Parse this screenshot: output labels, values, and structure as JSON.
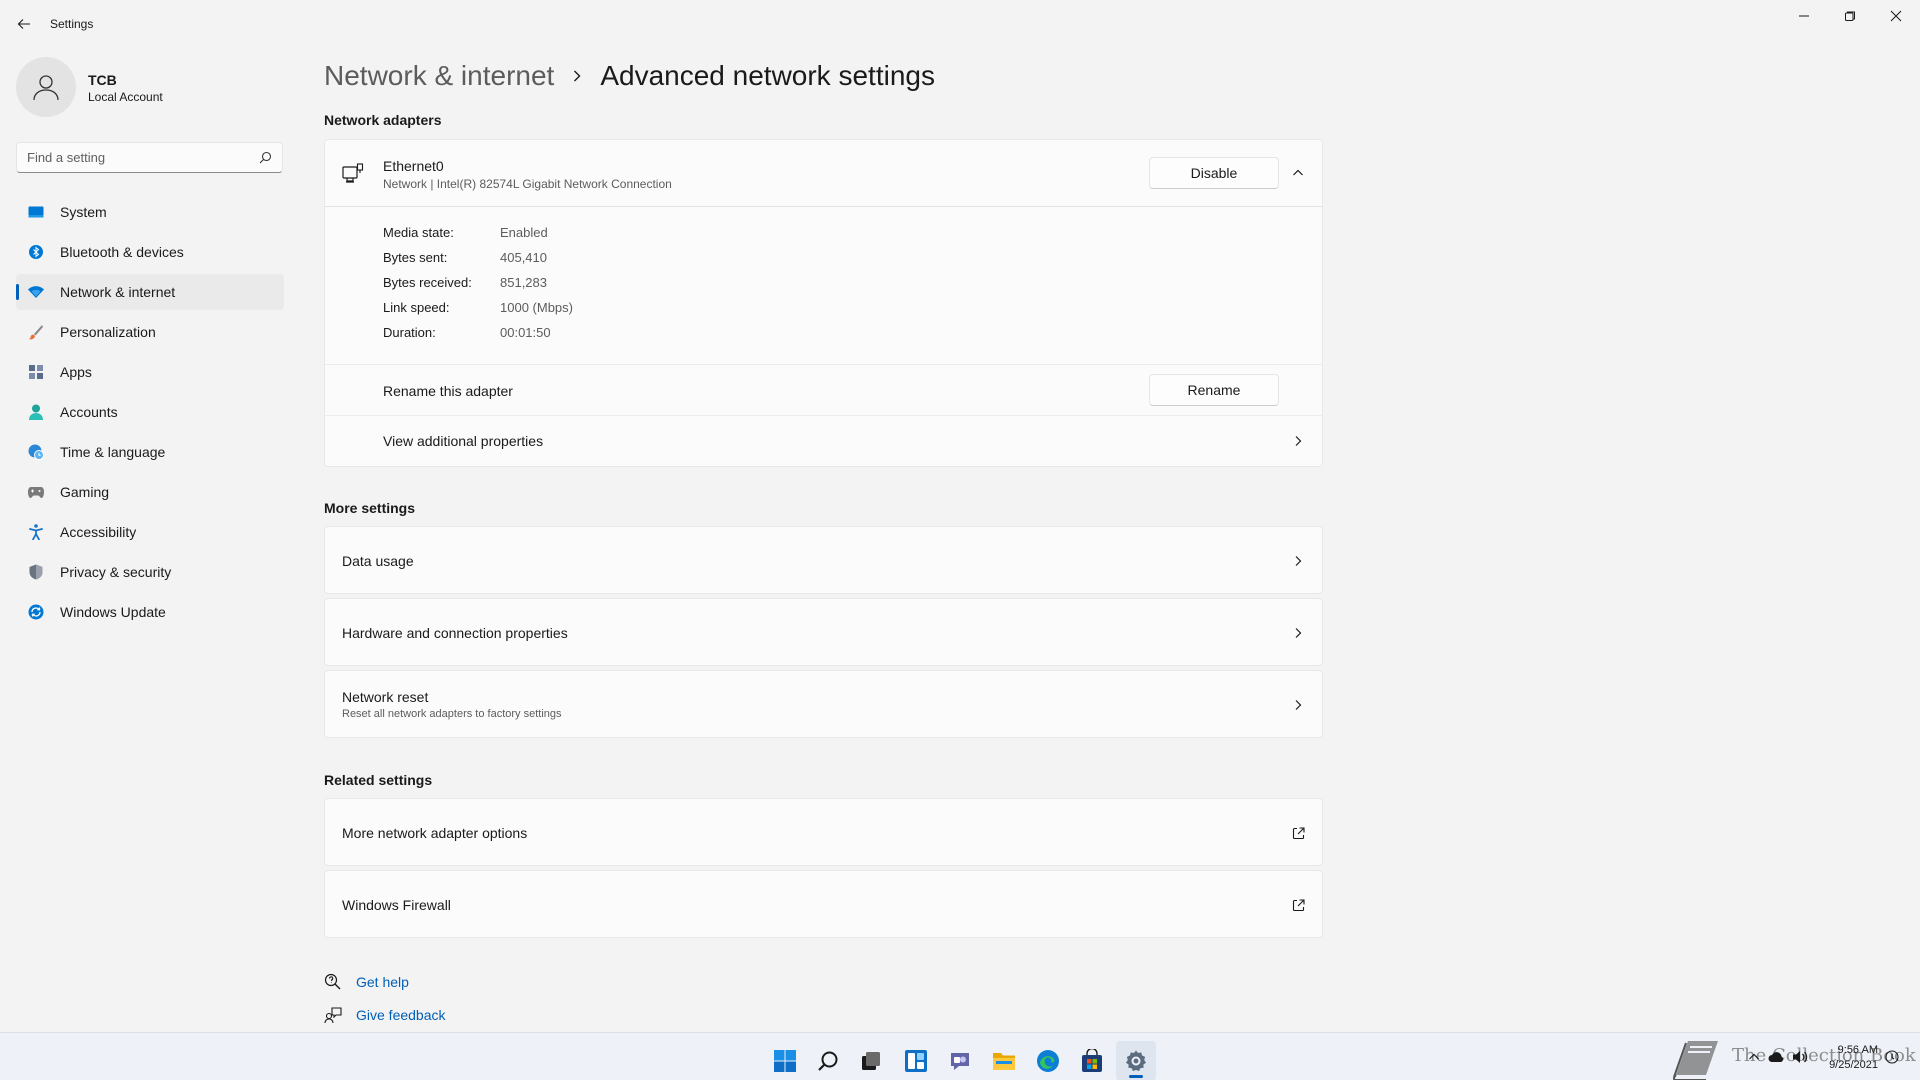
{
  "window": {
    "title": "Settings",
    "back_icon": "back-arrow-icon",
    "controls": [
      "minimize-icon",
      "restore-icon",
      "close-icon"
    ]
  },
  "profile": {
    "name": "TCB",
    "account_type": "Local Account",
    "avatar_icon": "person-icon"
  },
  "search": {
    "placeholder": "Find a setting",
    "icon": "search-icon"
  },
  "nav": {
    "items": [
      {
        "label": "System",
        "icon": "monitor-icon",
        "color": "#0078d4"
      },
      {
        "label": "Bluetooth & devices",
        "icon": "bluetooth-icon",
        "color": "#0078d4"
      },
      {
        "label": "Network & internet",
        "icon": "wifi-icon",
        "color": "#0078d4",
        "selected": true
      },
      {
        "label": "Personalization",
        "icon": "brush-icon",
        "color": "#e6713a"
      },
      {
        "label": "Apps",
        "icon": "apps-icon",
        "color": "#5a6c8c"
      },
      {
        "label": "Accounts",
        "icon": "person-icon",
        "color": "#1ba39c"
      },
      {
        "label": "Time & language",
        "icon": "globe-clock-icon",
        "color": "#2b88d8"
      },
      {
        "label": "Gaming",
        "icon": "controller-icon",
        "color": "#7a7a7a"
      },
      {
        "label": "Accessibility",
        "icon": "accessibility-icon",
        "color": "#1a73c8"
      },
      {
        "label": "Privacy & security",
        "icon": "shield-icon",
        "color": "#6b7280"
      },
      {
        "label": "Windows Update",
        "icon": "update-icon",
        "color": "#0078d4"
      }
    ]
  },
  "breadcrumb": {
    "parent": "Network & internet",
    "current": "Advanced network settings"
  },
  "adapters": {
    "section_title": "Network adapters",
    "adapter": {
      "name": "Ethernet0",
      "description": "Network | Intel(R) 82574L Gigabit Network Connection",
      "disable_label": "Disable",
      "expanded": true,
      "properties": [
        {
          "label": "Media state:",
          "value": "Enabled"
        },
        {
          "label": "Bytes sent:",
          "value": "405,410"
        },
        {
          "label": "Bytes received:",
          "value": "851,283"
        },
        {
          "label": "Link speed:",
          "value": "1000 (Mbps)"
        },
        {
          "label": "Duration:",
          "value": "00:01:50"
        }
      ],
      "rename_label": "Rename this adapter",
      "rename_button": "Rename",
      "view_properties_label": "View additional properties"
    }
  },
  "more_settings": {
    "section_title": "More settings",
    "items": [
      {
        "title": "Data usage"
      },
      {
        "title": "Hardware and connection properties"
      },
      {
        "title": "Network reset",
        "subtitle": "Reset all network adapters to factory settings"
      }
    ]
  },
  "related_settings": {
    "section_title": "Related settings",
    "items": [
      {
        "title": "More network adapter options"
      },
      {
        "title": "Windows Firewall"
      }
    ]
  },
  "help_links": {
    "get_help": "Get help",
    "give_feedback": "Give feedback"
  },
  "taskbar": {
    "apps": [
      "start-icon",
      "search-icon",
      "task-view-icon",
      "widgets-icon",
      "chat-icon",
      "file-explorer-icon",
      "edge-icon",
      "store-icon",
      "settings-icon"
    ],
    "active_app": "settings-icon",
    "time": "9:56 AM",
    "date": "9/25/2021",
    "watermark": "The Collection Book"
  },
  "colors": {
    "accent": "#005fb8",
    "background": "#f3f3f3",
    "card": "#fbfbfb"
  }
}
